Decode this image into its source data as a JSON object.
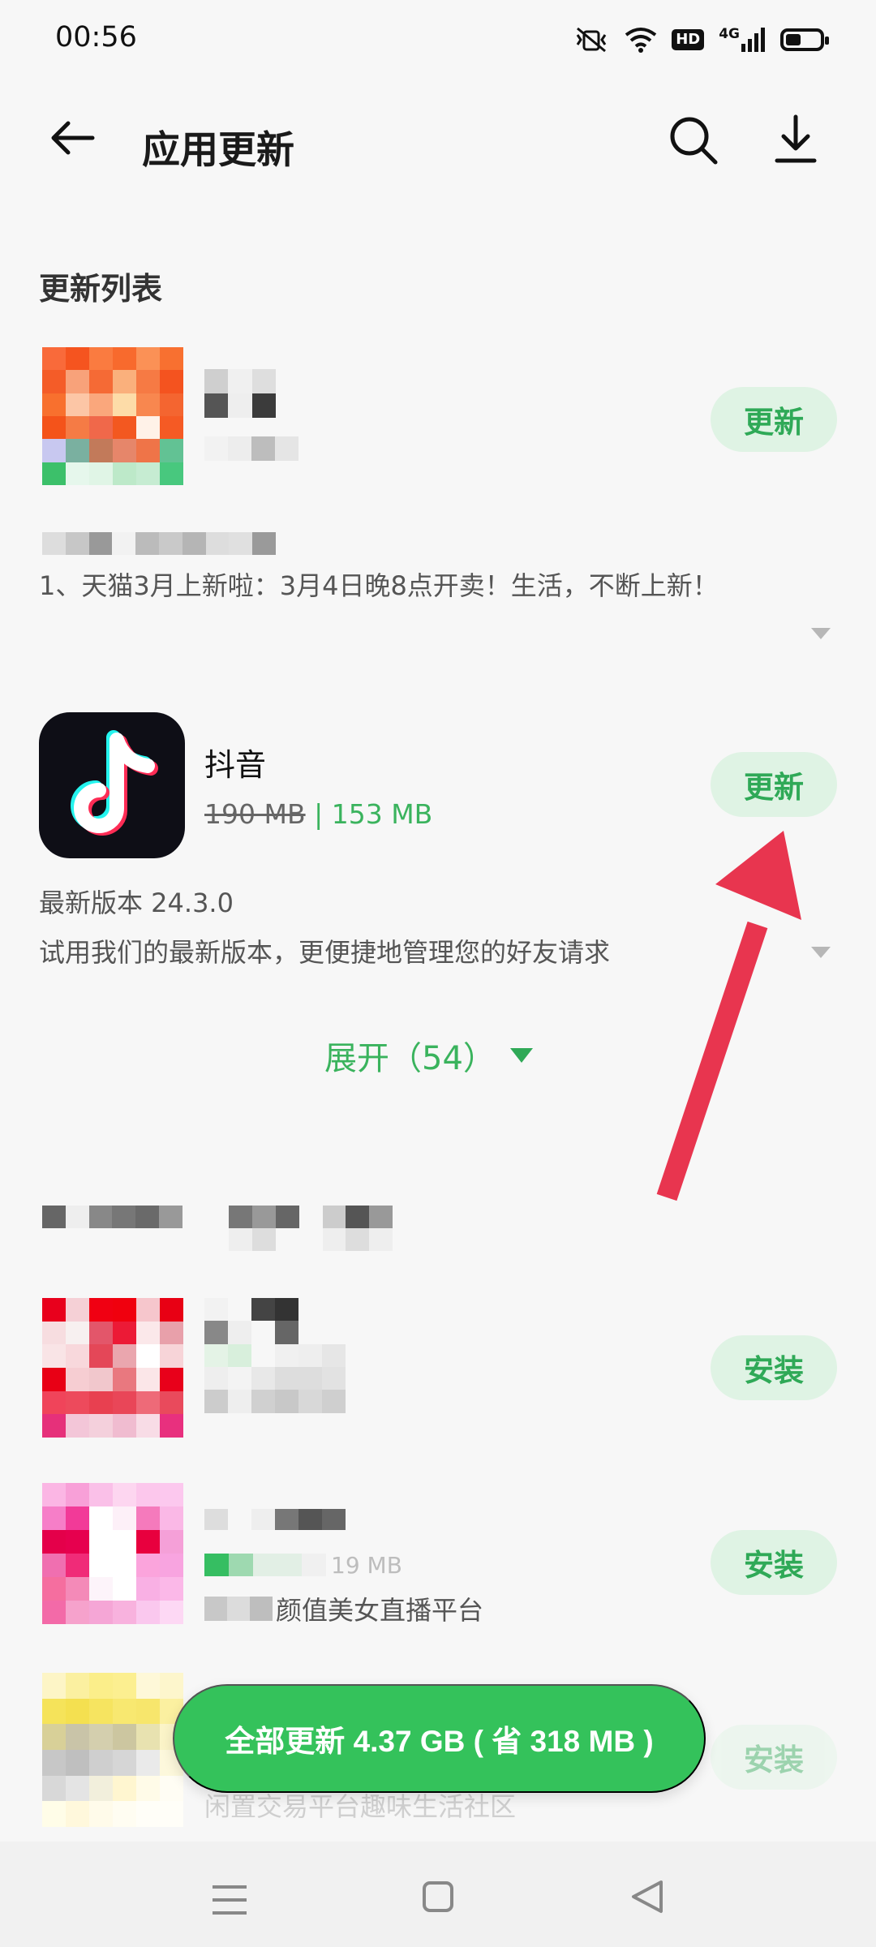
{
  "status_bar": {
    "time": "00:56",
    "network": "4G",
    "hd": "HD",
    "battery_percent": 45
  },
  "header": {
    "title": "应用更新",
    "icons": [
      "back-arrow-icon",
      "search-icon",
      "download-icon"
    ]
  },
  "section": {
    "title": "更新列表"
  },
  "items": [
    {
      "description": "1、天猫3月上新啦：3月4日晚8点开卖！生活，不断上新！",
      "button": "更新"
    },
    {
      "name": "抖音",
      "size_old": "190 MB",
      "size_separator": "|",
      "size_new": "153 MB",
      "version": "最新版本 24.3.0",
      "description": "试用我们的最新版本，更便捷地管理您的好友请求",
      "button": "更新"
    }
  ],
  "expand": {
    "label": "展开（54）"
  },
  "recommend": [
    {
      "button": "安装"
    },
    {
      "size_fragment": "19 MB",
      "tagline": "颜值美女直播平台",
      "button": "安装"
    },
    {
      "tagline": "闲置交易平台趣味生活社区",
      "button": "安装"
    }
  ],
  "bottom_action": {
    "label": "全部更新 4.37 GB ( 省 318 MB )"
  },
  "colors": {
    "accent": "#34c25b",
    "pill_bg": "#dff3e4",
    "arrow": "#e8354f"
  }
}
